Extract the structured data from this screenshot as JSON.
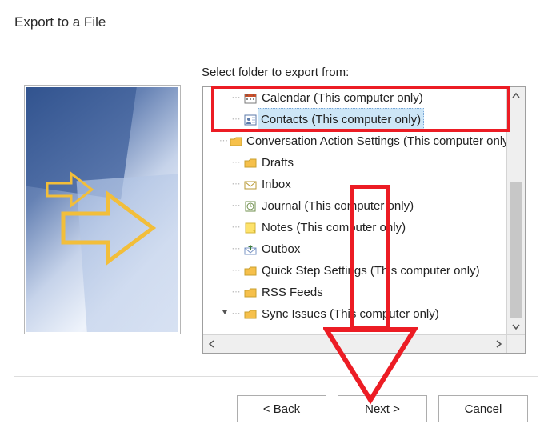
{
  "title": "Export to a File",
  "label": "Select folder to export from:",
  "tree": {
    "items": [
      {
        "label": "Calendar (This computer only)",
        "icon": "calendar",
        "selected": false,
        "expander": ""
      },
      {
        "label": "Contacts (This computer only)",
        "icon": "contacts",
        "selected": true,
        "expander": ""
      },
      {
        "label": "Conversation Action Settings (This computer only)",
        "icon": "folder",
        "selected": false,
        "expander": ""
      },
      {
        "label": "Drafts",
        "icon": "folder",
        "selected": false,
        "expander": ""
      },
      {
        "label": "Inbox",
        "icon": "inbox",
        "selected": false,
        "expander": ""
      },
      {
        "label": "Journal (This computer only)",
        "icon": "journal",
        "selected": false,
        "expander": ""
      },
      {
        "label": "Notes (This computer only)",
        "icon": "notes",
        "selected": false,
        "expander": ""
      },
      {
        "label": "Outbox",
        "icon": "outbox",
        "selected": false,
        "expander": ""
      },
      {
        "label": "Quick Step Settings (This computer only)",
        "icon": "folder",
        "selected": false,
        "expander": ""
      },
      {
        "label": "RSS Feeds",
        "icon": "folder",
        "selected": false,
        "expander": ""
      },
      {
        "label": "Sync Issues (This computer only)",
        "icon": "folder",
        "selected": false,
        "expander": "v"
      }
    ]
  },
  "buttons": {
    "back": "<  Back",
    "next": "Next  >",
    "cancel": "Cancel"
  }
}
